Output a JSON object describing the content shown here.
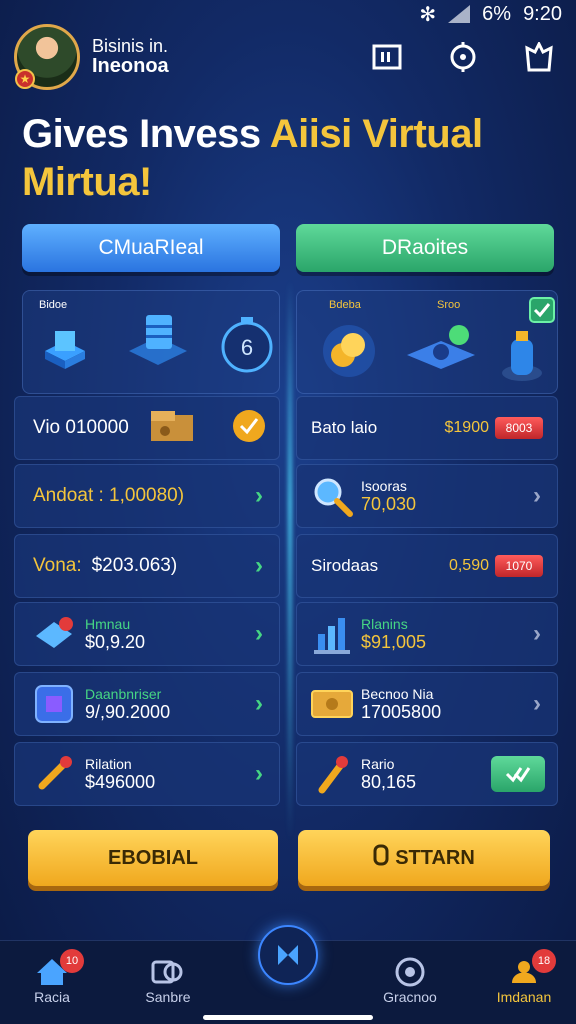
{
  "status_bar": {
    "battery": "6%",
    "time": "9:20"
  },
  "header": {
    "user_line1": "Bisinis in.",
    "user_line2": "Ineonoa"
  },
  "title": {
    "part1": "Gives Invess ",
    "part2": "Aiisi",
    "part3": " Virtual",
    "line2": "Mirtua!"
  },
  "tabs": {
    "left": "CMuaRIeal",
    "right": "DRaoites"
  },
  "showcase_left": {
    "label": "Bidoe",
    "timer": "6"
  },
  "showcase_right": {
    "label1": "Bdeba",
    "label2": "Sroo"
  },
  "left_rows": [
    {
      "text": "Vio 010000"
    },
    {
      "text": "Andoat : 1,00080)"
    },
    {
      "label": "Vona:",
      "value": "$203.063)"
    },
    {
      "name": "Hmnau",
      "value": "$0,9.20"
    },
    {
      "name": "Daanbnriser",
      "value": "9/,90.2000"
    },
    {
      "name": "Rilation",
      "value": "$496000"
    }
  ],
  "right_rows": [
    {
      "text": "Bato laio",
      "value": "$1900",
      "badge": "8003"
    },
    {
      "name": "Isooras",
      "value": "70,030"
    },
    {
      "text": "Sirodaas",
      "value": "0,590",
      "badge": "1070"
    },
    {
      "name": "Rlanins",
      "value": "$91,005"
    },
    {
      "name": "Becnoo Nia",
      "value": "17005800"
    },
    {
      "name": "Rario",
      "value": "80,165"
    }
  ],
  "buttons": {
    "left": "EBOBIAL",
    "right": "STTARN"
  },
  "nav": [
    {
      "label": "Racia",
      "badge": "10"
    },
    {
      "label": "Sanbre"
    },
    {
      "label": ""
    },
    {
      "label": "Gracnoo"
    },
    {
      "label": "Imdanan",
      "badge": "18"
    }
  ],
  "colors": {
    "accent_gold": "#f4c53c",
    "accent_green": "#46d684",
    "accent_blue": "#2a74e0"
  }
}
